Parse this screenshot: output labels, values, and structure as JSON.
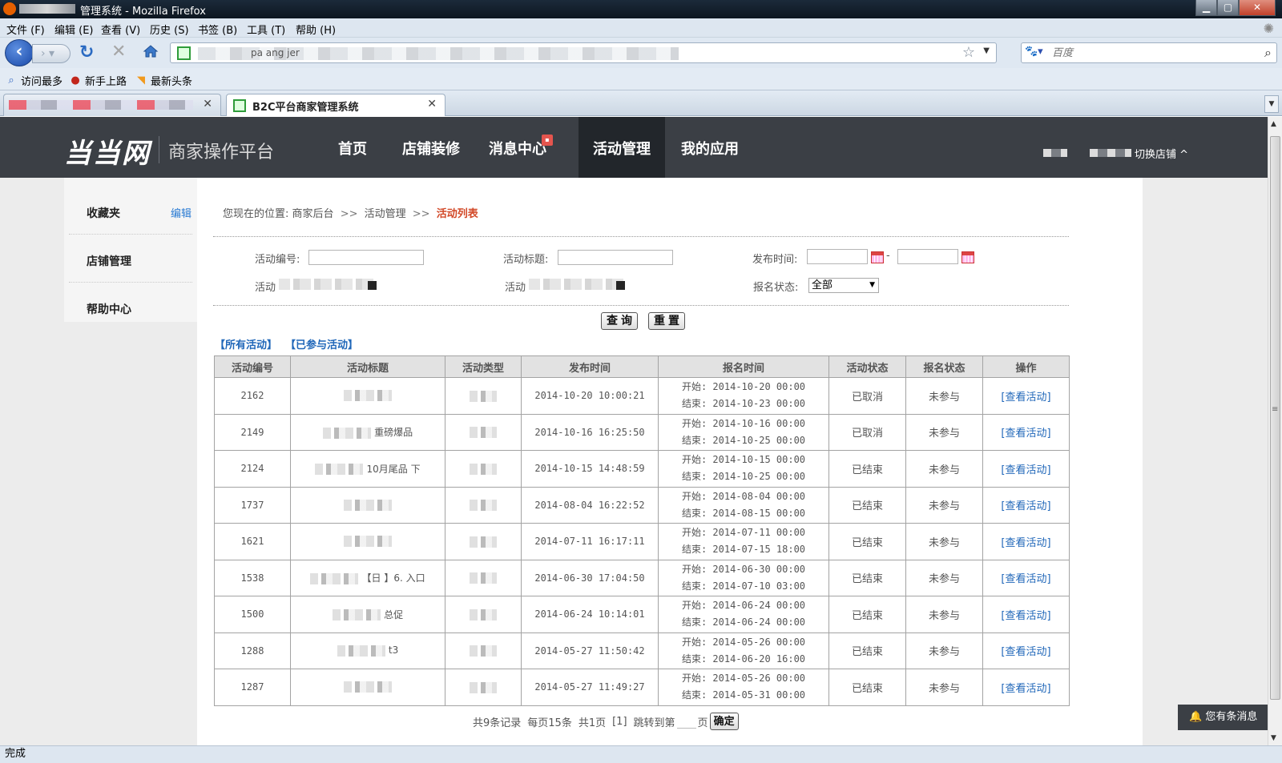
{
  "browser": {
    "window_title": "管理系统 - Mozilla Firefox",
    "window_buttons": [
      "▁",
      "▢",
      "✕"
    ],
    "menu": [
      "文件 (F)",
      "编辑 (E)",
      "查看 (V)",
      "历史 (S)",
      "书签 (B)",
      "工具 (T)",
      "帮助 (H)"
    ],
    "url_fragment": "pa      ang                   jer",
    "search_placeholder": "百度",
    "bookmarks": [
      "访问最多",
      "新手上路",
      "最新头条"
    ],
    "active_tab_title": "B2C平台商家管理系统",
    "status": "完成"
  },
  "header": {
    "logo": "当当网",
    "platform": "商家操作平台",
    "nav": [
      "首页",
      "店铺装修",
      "消息中心",
      "活动管理",
      "我的应用"
    ],
    "active_nav": "活动管理",
    "switch_store": "切换店铺 ^"
  },
  "sidebar": {
    "favorites": "收藏夹",
    "edit": "编辑",
    "store_mgmt": "店铺管理",
    "help": "帮助中心"
  },
  "breadcrumb": {
    "prefix": "您现在的位置:",
    "home": "商家后台",
    "sep": ">>",
    "section": "活动管理",
    "current": "活动列表"
  },
  "filters": {
    "activity_id": "活动编号:",
    "activity_title": "活动标题:",
    "publish_time": "发布时间:",
    "dash": "-",
    "activity_x": "活动",
    "activity_y": "活动",
    "signup_status": "报名状态:",
    "signup_status_value": "全部",
    "query": "查询",
    "reset": "重置"
  },
  "tabs": {
    "all": "【所有活动】",
    "joined": "【已参与活动】"
  },
  "table": {
    "headers": [
      "活动编号",
      "活动标题",
      "活动类型",
      "发布时间",
      "报名时间",
      "活动状态",
      "报名状态",
      "操作"
    ],
    "rows": [
      {
        "id": "2162",
        "title": "",
        "published": "2014-10-20 10:00:21",
        "start": "开始: 2014-10-20 00:00",
        "end": "结束: 2014-10-23 00:00",
        "state": "已取消",
        "signup": "未参与",
        "op": "[查看活动]"
      },
      {
        "id": "2149",
        "title": "重磅爆品",
        "published": "2014-10-16 16:25:50",
        "start": "开始: 2014-10-16 00:00",
        "end": "结束: 2014-10-25 00:00",
        "state": "已取消",
        "signup": "未参与",
        "op": "[查看活动]"
      },
      {
        "id": "2124",
        "title": "10月尾品 下",
        "published": "2014-10-15 14:48:59",
        "start": "开始: 2014-10-15 00:00",
        "end": "结束: 2014-10-25 00:00",
        "state": "已结束",
        "signup": "未参与",
        "op": "[查看活动]"
      },
      {
        "id": "1737",
        "title": "",
        "published": "2014-08-04 16:22:52",
        "start": "开始: 2014-08-04 00:00",
        "end": "结束: 2014-08-15 00:00",
        "state": "已结束",
        "signup": "未参与",
        "op": "[查看活动]"
      },
      {
        "id": "1621",
        "title": "",
        "published": "2014-07-11 16:17:11",
        "start": "开始: 2014-07-11 00:00",
        "end": "结束: 2014-07-15 18:00",
        "state": "已结束",
        "signup": "未参与",
        "op": "[查看活动]"
      },
      {
        "id": "1538",
        "title": "【日 】6. 入口",
        "published": "2014-06-30 17:04:50",
        "start": "开始: 2014-06-30 00:00",
        "end": "结束: 2014-07-10 03:00",
        "state": "已结束",
        "signup": "未参与",
        "op": "[查看活动]"
      },
      {
        "id": "1500",
        "title": "总促",
        "published": "2014-06-24 10:14:01",
        "start": "开始: 2014-06-24 00:00",
        "end": "结束: 2014-06-24 00:00",
        "state": "已结束",
        "signup": "未参与",
        "op": "[查看活动]"
      },
      {
        "id": "1288",
        "title": "t3",
        "published": "2014-05-27 11:50:42",
        "start": "开始: 2014-05-26 00:00",
        "end": "结束: 2014-06-20 16:00",
        "state": "已结束",
        "signup": "未参与",
        "op": "[查看活动]"
      },
      {
        "id": "1287",
        "title": "",
        "published": "2014-05-27 11:49:27",
        "start": "开始: 2014-05-26 00:00",
        "end": "结束: 2014-05-31 00:00",
        "state": "已结束",
        "signup": "未参与",
        "op": "[查看活动]"
      }
    ]
  },
  "pager": {
    "total": "共9条记录",
    "per_page": "每页15条",
    "pages": "共1页",
    "current": "[1]",
    "jump": "跳转到第",
    "page_unit": "页",
    "ok": "确定"
  },
  "message_box": "您有条消息"
}
